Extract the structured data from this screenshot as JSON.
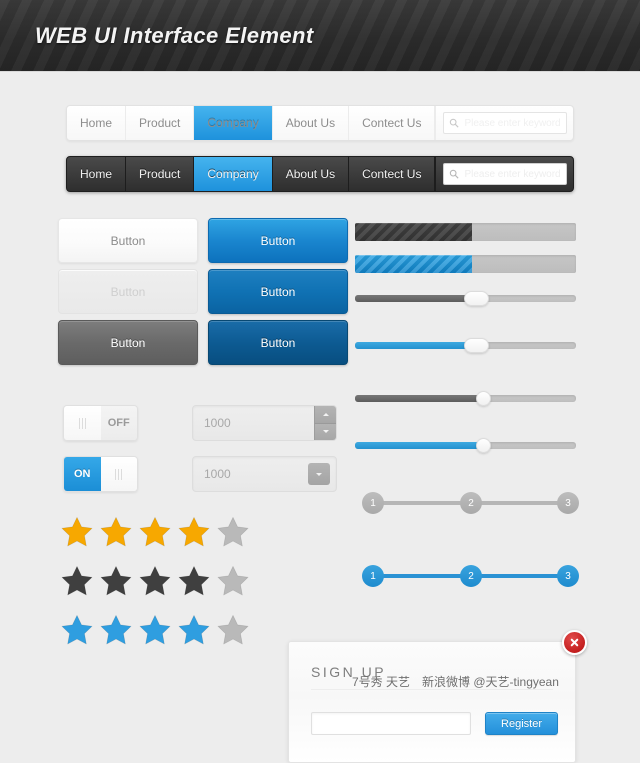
{
  "header": {
    "title": "WEB UI Interface Element"
  },
  "nav": {
    "items": [
      "Home",
      "Product",
      "Company",
      "About Us",
      "Contect Us"
    ],
    "active": "Company",
    "search_placeholder": "Please enter keyword",
    "search_value": "",
    "search_icon": "search-icon"
  },
  "buttons": {
    "white_label": "Button",
    "disabled_label": "Button",
    "gray_label": "Button",
    "blue1_label": "Button",
    "blue2_label": "Button",
    "blue3_label": "Button"
  },
  "progress": [
    {
      "name": "dark",
      "percent": 53
    },
    {
      "name": "blue",
      "percent": 53
    }
  ],
  "sliders": [
    {
      "name": "gray-rect",
      "percent": 55
    },
    {
      "name": "blue-rect",
      "percent": 55
    },
    {
      "name": "gray-circle",
      "percent": 58
    },
    {
      "name": "blue-circle",
      "percent": 58
    }
  ],
  "toggles": [
    {
      "state": "OFF",
      "label": "OFF",
      "handle_side": "left"
    },
    {
      "state": "ON",
      "label": "ON",
      "handle_side": "right"
    }
  ],
  "steppers": [
    {
      "value": "1000",
      "type": "updown"
    },
    {
      "value": "1000",
      "type": "single"
    }
  ],
  "steps": [
    {
      "style": "gray",
      "labels": [
        "1",
        "2",
        "3"
      ]
    },
    {
      "style": "blue",
      "labels": [
        "1",
        "2",
        "3"
      ]
    }
  ],
  "ratings": [
    {
      "color": "#f7a800",
      "filled": 4,
      "total": 5
    },
    {
      "color": "#3f3f3f",
      "filled": 4,
      "total": 5
    },
    {
      "color": "#2f9ee0",
      "filled": 4,
      "total": 5
    }
  ],
  "modal": {
    "title": "SIGN UP",
    "input_value": "",
    "input_placeholder": "",
    "register_label": "Register",
    "close_icon": "close-icon"
  },
  "footer": {
    "text": "7号秀 天艺　新浪微博 @天艺-tingyean"
  },
  "colors": {
    "accent_blue": "#1e92dc",
    "header_dark": "#2c2c2c",
    "page_bg": "#ededed",
    "star_gold": "#f7a800",
    "star_gray": "#b9b9b9",
    "close_red": "#c41f1f"
  }
}
